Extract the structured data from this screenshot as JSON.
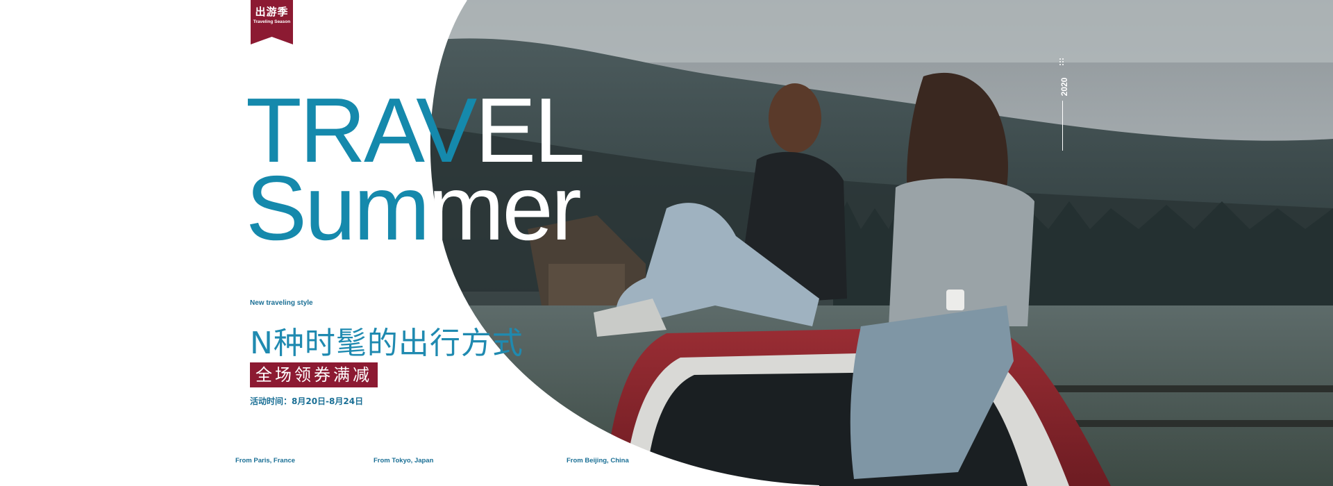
{
  "badge": {
    "title": "出游季",
    "subtitle": "Traveling Season",
    "color": "#8c1a32"
  },
  "headline": {
    "line1_blue": "TRAV",
    "line1_white": "EL",
    "line2_blue": "Sum",
    "line2_white": "mer",
    "accent_color": "#1589ac"
  },
  "tagline": "New traveling style",
  "cn_title": "N种时髦的出行方式",
  "promo": "全场领券满减",
  "dates": "活动时间：8月20日-8月24日",
  "origins": [
    "From Paris, France",
    "From Tokyo, Japan",
    "From Beijing, China"
  ],
  "year": "2020",
  "photo": {
    "subject": "two women sitting on a red car roof looking at misty mountains and forest",
    "icon": "travel-photo"
  }
}
